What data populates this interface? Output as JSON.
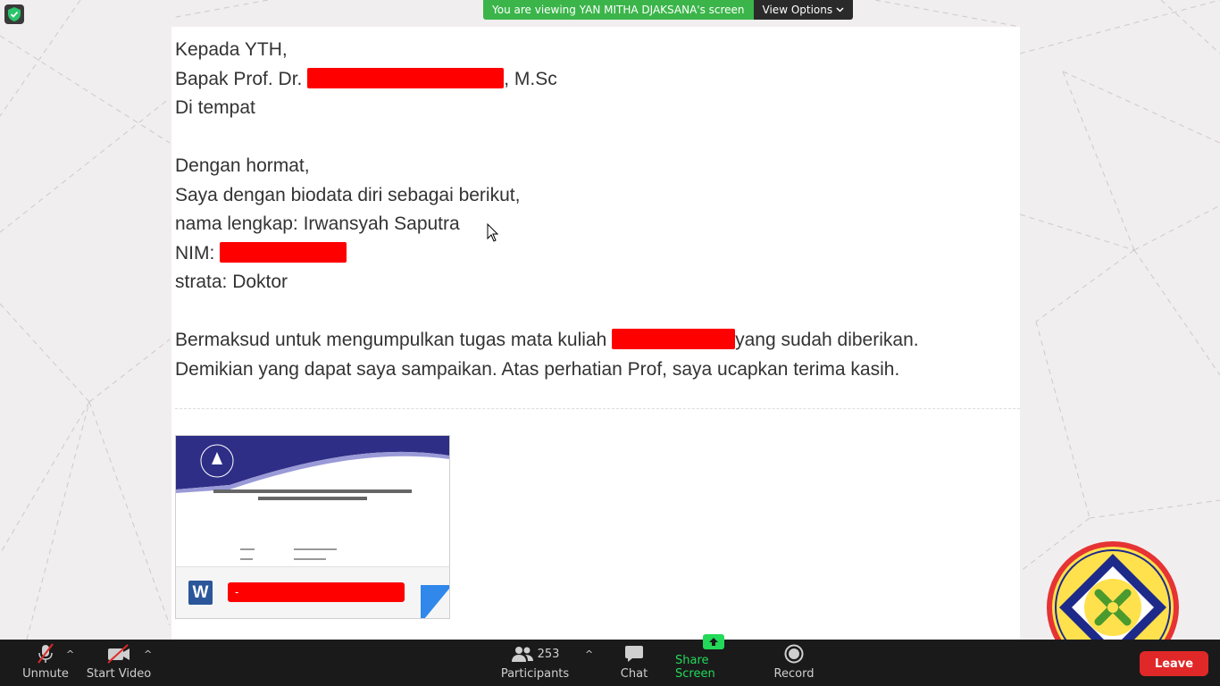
{
  "banner": {
    "viewing_text": "You are viewing YAN MITHA DJAKSANA's screen",
    "view_options": "View Options"
  },
  "letter": {
    "line1": "Kepada YTH,",
    "line2_prefix": "Bapak Prof. Dr. ",
    "line2_suffix": ", M.Sc",
    "line3": "Di tempat",
    "line5": "Dengan hormat,",
    "line6": "Saya dengan biodata diri sebagai berikut,",
    "line7": "nama lengkap: Irwansyah Saputra",
    "line8_prefix": "NIM: ",
    "line9": "strata: Doktor",
    "line11_prefix": "Bermaksud untuk mengumpulkan tugas mata kuliah ",
    "line11_suffix": "yang sudah diberikan.",
    "line12": "Demikian yang dapat saya sampaikan. Atas perhatian Prof, saya ucapkan terima kasih."
  },
  "attachment": {
    "file_type_icon": "W",
    "file_name": "-"
  },
  "toolbar": {
    "unmute": "Unmute",
    "start_video": "Start Video",
    "participants": "Participants",
    "participants_count": "253",
    "chat": "Chat",
    "share_screen": "Share Screen",
    "record": "Record",
    "leave": "Leave"
  },
  "colors": {
    "banner_green": "#3bb54a",
    "redaction": "#ff0000",
    "leave_red": "#e02828",
    "share_green": "#23d959"
  }
}
